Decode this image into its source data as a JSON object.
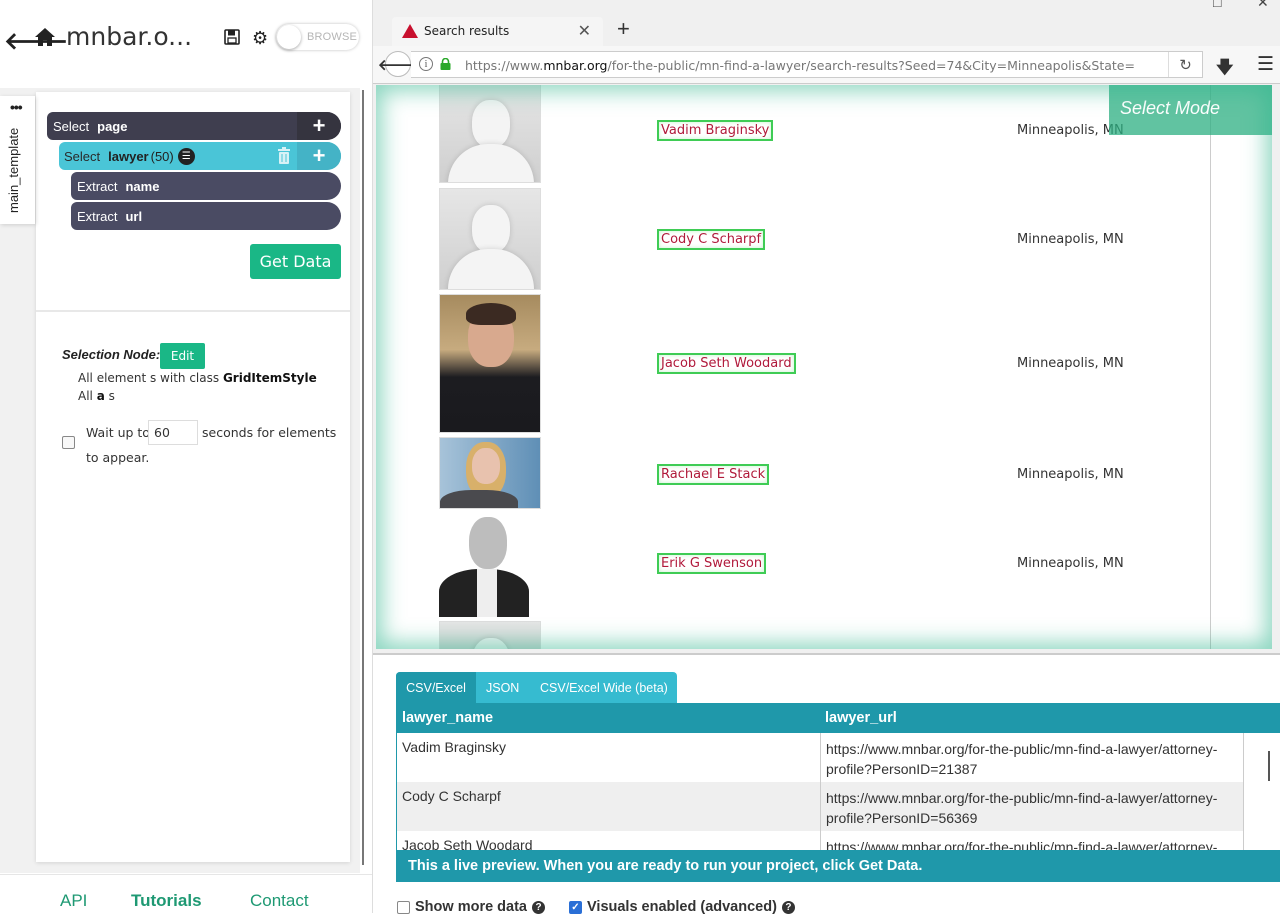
{
  "left_panel": {
    "project_title": "mnbar.o...",
    "browse_toggle_label": "BROWSE",
    "template_tab": "main_template",
    "template_menu_icon": "more-dots-icon",
    "commands": {
      "page": {
        "verb": "Select",
        "noun": "page"
      },
      "lawyer": {
        "verb": "Select",
        "noun": "lawyer",
        "count": "(50)"
      },
      "extract_name": {
        "verb": "Extract",
        "noun": "name"
      },
      "extract_url": {
        "verb": "Extract",
        "noun": "url"
      }
    },
    "get_data_label": "Get Data",
    "selection_node": {
      "label": "Selection Node:",
      "edit_label": "Edit",
      "line1_prefix": "All element s with class ",
      "line1_class": "GridItemStyle",
      "line2_prefix": "All ",
      "line2_tag": "a",
      "line2_suffix": " s"
    },
    "wait": {
      "checked": false,
      "prefix": "Wait up to",
      "seconds": "60",
      "suffix": "seconds for elements",
      "suffix2": "to appear."
    },
    "footer": {
      "api": "API",
      "tutorials": "Tutorials",
      "contact": "Contact"
    }
  },
  "browser": {
    "tab_title": "Search results",
    "url_scheme_prefix": "https://www.",
    "url_host": "mnbar.org",
    "url_path": "/for-the-public/mn-find-a-lawyer/search-results?Seed=74&City=Minneapolis&State=",
    "select_mode_label": "Select Mode",
    "lawyers": [
      {
        "name": "Vadim Braginsky",
        "city": "Minneapolis, MN",
        "photo": "generic"
      },
      {
        "name": "Cody C Scharpf",
        "city": "Minneapolis, MN",
        "photo": "generic"
      },
      {
        "name": "Jacob Seth Woodard",
        "city": "Minneapolis, MN",
        "photo": "photo"
      },
      {
        "name": "Rachael E Stack",
        "city": "Minneapolis, MN",
        "photo": "photo"
      },
      {
        "name": "Erik G Swenson",
        "city": "Minneapolis, MN",
        "photo": "photo"
      }
    ]
  },
  "preview": {
    "tabs": [
      "CSV/Excel",
      "JSON",
      "CSV/Excel Wide (beta)"
    ],
    "active_tab": "CSV/Excel",
    "columns": [
      "lawyer_name",
      "lawyer_url"
    ],
    "rows": [
      {
        "lawyer_name": "Vadim Braginsky",
        "lawyer_url_1": "https://www.mnbar.org/for-the-public/mn-find-a-lawyer/attorney-",
        "lawyer_url_2": "profile?PersonID=21387"
      },
      {
        "lawyer_name": "Cody C Scharpf",
        "lawyer_url_1": "https://www.mnbar.org/for-the-public/mn-find-a-lawyer/attorney-",
        "lawyer_url_2": "profile?PersonID=56369"
      },
      {
        "lawyer_name": "Jacob Seth Woodard",
        "lawyer_url_1": "https://www.mnbar.org/for-the-public/mn-find-a-lawyer/attorney-",
        "lawyer_url_2": ""
      }
    ],
    "live_banner": "This a live preview. When you are ready to run your project, click Get Data.",
    "show_more_data": {
      "label": "Show more data",
      "checked": false
    },
    "visuals_enabled": {
      "label": "Visuals enabled (advanced)",
      "checked": true
    }
  },
  "colors": {
    "accent_green": "#1ab786",
    "teal": "#1f98aa",
    "cyan": "#4ac5d7",
    "dark_cmd": "#3f3e4f",
    "link_red": "#b01a3a"
  }
}
